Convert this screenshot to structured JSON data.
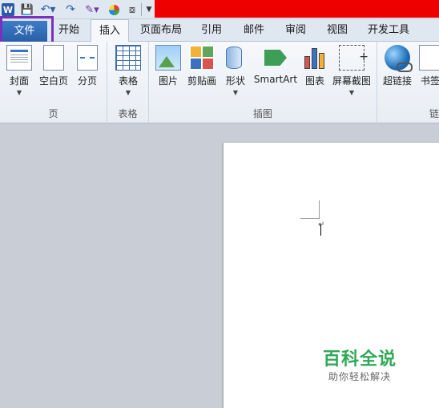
{
  "qat": {
    "app_icon": "word-icon",
    "app_letter": "W"
  },
  "tabs": [
    {
      "label": "文件"
    },
    {
      "label": "开始"
    },
    {
      "label": "插入"
    },
    {
      "label": "页面布局"
    },
    {
      "label": "引用"
    },
    {
      "label": "邮件"
    },
    {
      "label": "审阅"
    },
    {
      "label": "视图"
    },
    {
      "label": "开发工具"
    }
  ],
  "ribbon": {
    "groups": [
      {
        "label": "页",
        "buttons": [
          {
            "label": "封面",
            "icon": "cover-page-icon"
          },
          {
            "label": "空白页",
            "icon": "blank-page-icon"
          },
          {
            "label": "分页",
            "icon": "page-break-icon"
          }
        ]
      },
      {
        "label": "表格",
        "buttons": [
          {
            "label": "表格",
            "icon": "table-icon"
          }
        ]
      },
      {
        "label": "插图",
        "buttons": [
          {
            "label": "图片",
            "icon": "picture-icon"
          },
          {
            "label": "剪贴画",
            "icon": "clip-art-icon"
          },
          {
            "label": "形状",
            "icon": "shapes-icon"
          },
          {
            "label": "SmartArt",
            "icon": "smartart-icon"
          },
          {
            "label": "图表",
            "icon": "chart-icon"
          },
          {
            "label": "屏幕截图",
            "icon": "screenshot-icon"
          }
        ]
      },
      {
        "label": "链",
        "buttons": [
          {
            "label": "超链接",
            "icon": "hyperlink-icon"
          },
          {
            "label": "书签",
            "icon": "bookmark-icon"
          }
        ]
      }
    ]
  },
  "watermark": {
    "title": "百科全说",
    "subtitle": "助你轻松解决"
  },
  "colors": {
    "file_tab": "#2b5fa8",
    "highlight": "#7b2fbf",
    "title_bar": "#ee0000",
    "watermark": "#2fa957"
  }
}
